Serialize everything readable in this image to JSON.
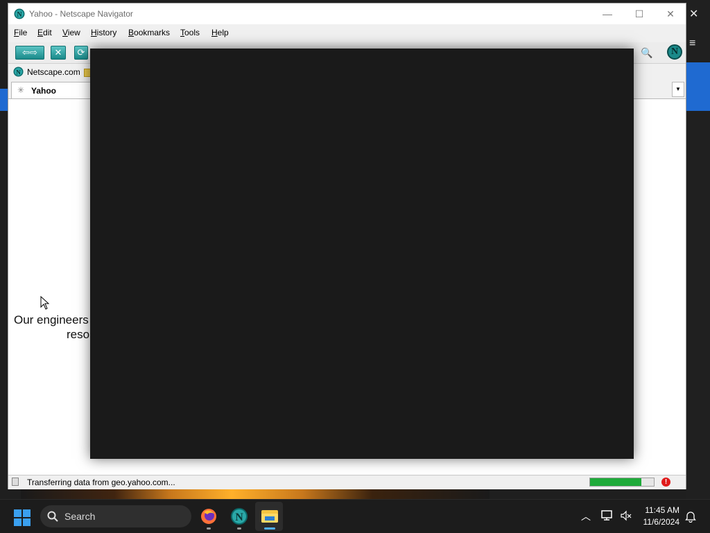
{
  "window": {
    "title": "Yahoo - Netscape Navigator",
    "minimize_glyph": "—",
    "maximize_glyph": "☐",
    "close_glyph": "✕"
  },
  "menu": [
    "File",
    "Edit",
    "View",
    "History",
    "Bookmarks",
    "Tools",
    "Help"
  ],
  "toolbar": {
    "back_forward_glyph": "⇦⇨",
    "stop_glyph": "✕",
    "reload_glyph": "⟳",
    "search_glyph": "🔍",
    "logo_letter": "N"
  },
  "bookmarks": {
    "item": "Netscape.com"
  },
  "tabs": [
    {
      "label": "Yahoo"
    }
  ],
  "content": {
    "message_line1": "Our engineers",
    "message_line2": "reso"
  },
  "status": {
    "text": "Transferring data from geo.yahoo.com...",
    "progress_fraction": 0.8,
    "error_glyph": "!"
  },
  "taskbar": {
    "search_label": "Search",
    "time": "11:45 AM",
    "date": "11/6/2024",
    "apps": [
      "firefox-icon",
      "netscape-icon",
      "file-explorer-icon"
    ]
  },
  "background": {
    "close_glyph": "✕",
    "menu_glyph": "≡"
  },
  "colors": {
    "accent_teal": "#1a8a8a",
    "progress_green": "#1faa3a",
    "overlay_dark": "#1a1a1a",
    "blue_strip": "#1f6ad1"
  }
}
